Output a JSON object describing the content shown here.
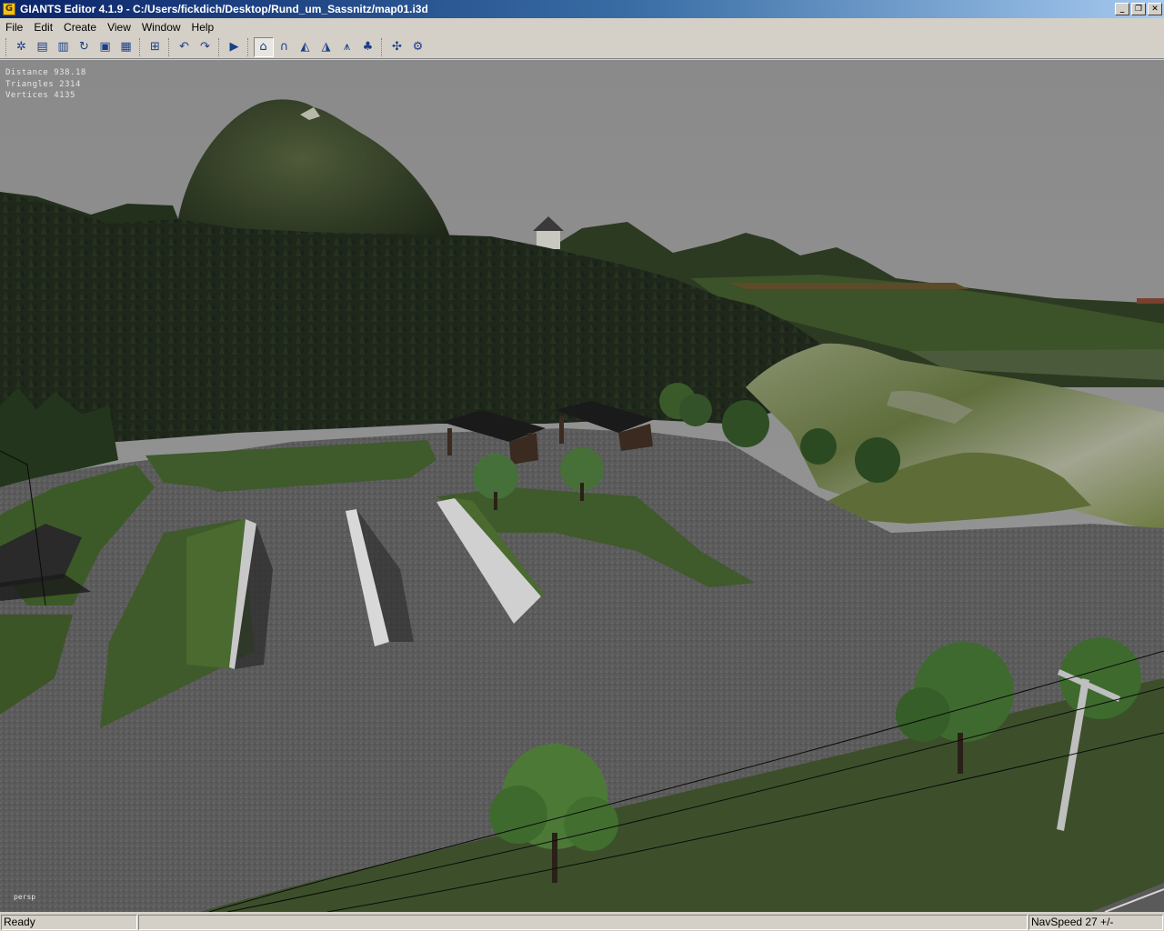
{
  "window": {
    "title": "GIANTS Editor 4.1.9 - C:/Users/fickdich/Desktop/Rund_um_Sassnitz/map01.i3d",
    "app_icon_letter": "G",
    "controls": {
      "minimize": "_",
      "restore": "❐",
      "close": "✕"
    }
  },
  "menu": {
    "items": [
      {
        "label": "File"
      },
      {
        "label": "Edit"
      },
      {
        "label": "Create"
      },
      {
        "label": "View"
      },
      {
        "label": "Window"
      },
      {
        "label": "Help"
      }
    ]
  },
  "toolbar": {
    "buttons": [
      {
        "icon": "new-scene-icon",
        "glyph": "✲"
      },
      {
        "icon": "open-icon",
        "glyph": "▤"
      },
      {
        "icon": "document-icon",
        "glyph": "▥"
      },
      {
        "icon": "reload-icon",
        "glyph": "↻"
      },
      {
        "icon": "save-icon",
        "glyph": "▣"
      },
      {
        "icon": "save-all-icon",
        "glyph": "▦"
      },
      {
        "icon": "import-icon",
        "glyph": "⊞"
      },
      {
        "icon": "undo-icon",
        "glyph": "↶"
      },
      {
        "icon": "redo-icon",
        "glyph": "↷"
      },
      {
        "icon": "play-icon",
        "glyph": "▶"
      },
      {
        "icon": "select-mode-icon",
        "glyph": "⌂"
      },
      {
        "icon": "move-mode-icon",
        "glyph": "∩"
      },
      {
        "icon": "terrain-sculpt-icon",
        "glyph": "◭"
      },
      {
        "icon": "terrain-paint-icon",
        "glyph": "◮"
      },
      {
        "icon": "foliage-paint-icon",
        "glyph": "⩚"
      },
      {
        "icon": "grass-paint-icon",
        "glyph": "♣"
      },
      {
        "icon": "particle-icon",
        "glyph": "✣"
      },
      {
        "icon": "settings-icon",
        "glyph": "⚙"
      }
    ]
  },
  "viewport": {
    "stats": {
      "distance": "Distance 938.18",
      "triangles": "Triangles 2314",
      "vertices": "Vertices 4135"
    },
    "camera_label": "persp",
    "colors": {
      "sky": "#8e8e8e",
      "forest": "#1f2a1a",
      "grass": "#3c5a27",
      "gravel": "#5e5e5e",
      "rock": "#5e6a46"
    }
  },
  "status": {
    "left_text": "Ready",
    "right_text": "NavSpeed 27 +/-"
  }
}
